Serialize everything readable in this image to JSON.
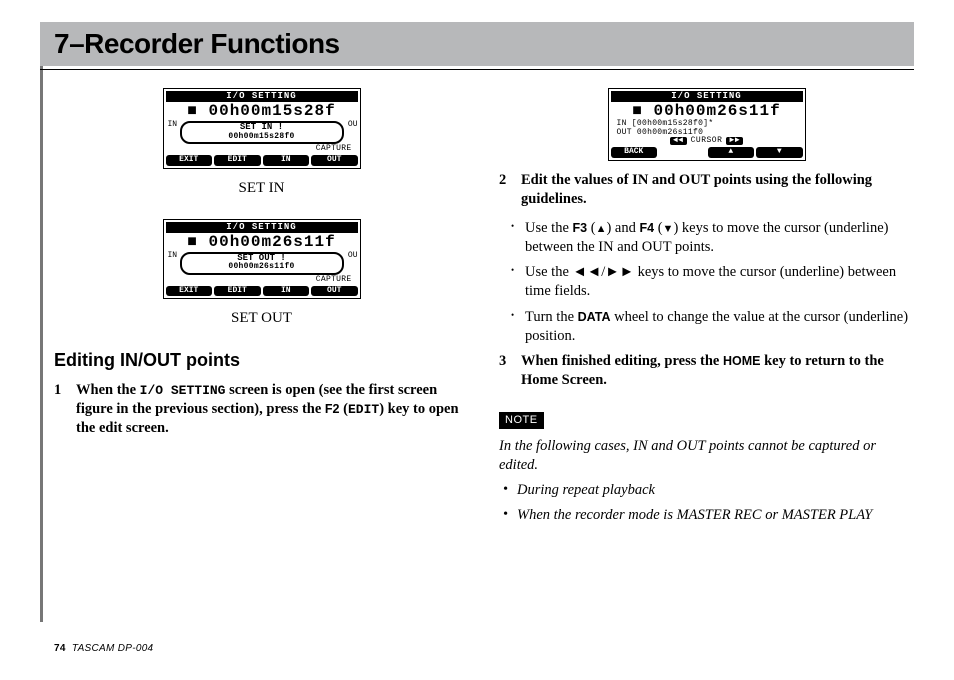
{
  "header": {
    "title": "7–Recorder Functions"
  },
  "left": {
    "lcd1": {
      "bar": "I/O SETTING",
      "time": "00h00m15s28f",
      "popup": "SET IN !",
      "popup_sub": "00h00m15s28f0",
      "edge_l": "IN",
      "edge_r": "OU",
      "capture": "CAPTURE",
      "fkeys": [
        "EXIT",
        "EDIT",
        "IN",
        "OUT"
      ]
    },
    "lcd1_label": "SET IN",
    "lcd2": {
      "bar": "I/O SETTING",
      "time": "00h00m26s11f",
      "popup": "SET OUT !",
      "popup_sub": "00h00m26s11f0",
      "edge_l": "IN",
      "edge_r": "OU",
      "capture": "CAPTURE",
      "fkeys": [
        "EXIT",
        "EDIT",
        "IN",
        "OUT"
      ]
    },
    "lcd2_label": "SET OUT",
    "section": "Editing IN/OUT points",
    "step1_pre": "When the ",
    "step1_mono": "I/O SETTING",
    "step1_mid": " screen is open (see the first screen figure in the previous section), press the ",
    "step1_key1": "F2",
    "step1_open": " (",
    "step1_mono2": "EDIT",
    "step1_close": ") key to open the edit screen."
  },
  "right": {
    "lcd3": {
      "bar": "I/O SETTING",
      "time": "00h00m26s11f",
      "in_line": "IN  [00h00m15s28f0]*",
      "out_line": "OUT  00h00m26s11f0",
      "cursor_left": "◄◄",
      "cursor_label": "CURSOR",
      "cursor_right": "►►",
      "fkeys": [
        "BACK",
        "",
        "▲",
        "▼"
      ]
    },
    "step2": "Edit the values of IN and OUT points using the following guidelines.",
    "b1_pre": "Use the ",
    "b1_k1": "F3",
    "b1_mid": " (",
    "b1_k1_sym": "▲",
    "b1_mid2": ") and ",
    "b1_k2": "F4",
    "b1_mid3": " (",
    "b1_k2_sym": "▼",
    "b1_tail": ") keys to move the cursor (underline) between the IN and OUT points.",
    "b2_pre": "Use the  ",
    "b2_sym": "◄◄/►►",
    "b2_tail": "  keys to move the cursor (underline) between time fields.",
    "b3_pre": "Turn the ",
    "b3_key": "DATA",
    "b3_tail": " wheel to change the value at the cursor (underline) position.",
    "step3_pre": "When finished editing, press the ",
    "step3_key": "HOME",
    "step3_tail": " key to return to the Home Screen.",
    "note_tag": "NOTE",
    "note_body": "In the following cases, IN and OUT points cannot be captured or edited.",
    "note_items": [
      "During repeat playback",
      "When the recorder mode is MASTER REC or MASTER PLAY"
    ]
  },
  "footer": {
    "page": "74",
    "model": "TASCAM  DP-004"
  }
}
